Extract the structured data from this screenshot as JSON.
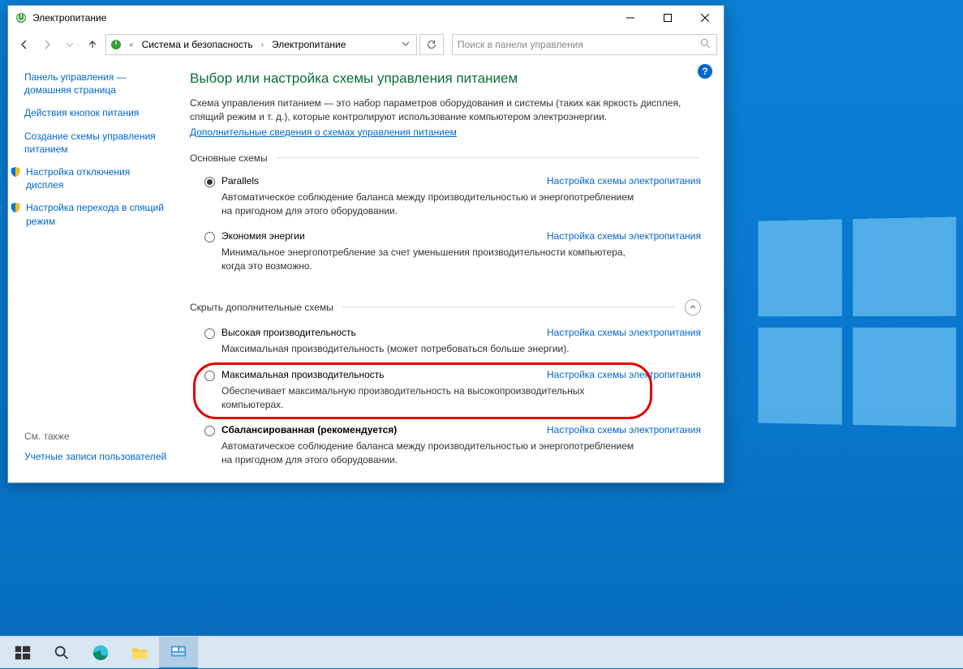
{
  "window": {
    "title": "Электропитание"
  },
  "breadcrumb": {
    "seg1": "Система и безопасность",
    "seg2": "Электропитание"
  },
  "search": {
    "placeholder": "Поиск в панели управления"
  },
  "sidebar": {
    "home": "Панель управления — домашняя страница",
    "item1": "Действия кнопок питания",
    "item2": "Создание схемы управления питанием",
    "item3": "Настройка отключения дисплея",
    "item4": "Настройка перехода в спящий режим",
    "see_also_label": "См. также",
    "see_also_item": "Учетные записи пользователей"
  },
  "content": {
    "heading": "Выбор или настройка схемы управления питанием",
    "desc": "Схема управления питанием — это набор параметров оборудования и системы (таких как яркость дисплея, спящий режим и т. д.), которые контролируют использование компьютером электроэнергии.",
    "desc_link": "Дополнительные сведения о схемах управления питанием",
    "section1_title": "Основные схемы",
    "section2_title": "Скрыть дополнительные схемы",
    "change_link": "Настройка схемы электропитания",
    "plans": [
      {
        "name": "Parallels",
        "desc": "Автоматическое соблюдение баланса между производительностью и энергопотреблением на пригодном для этого оборудовании.",
        "checked": true
      },
      {
        "name": "Экономия энергии",
        "desc": "Минимальное энергопотребление за счет уменьшения производительности компьютера, когда это возможно.",
        "checked": false
      },
      {
        "name": "Высокая производительность",
        "desc": "Максимальная производительность (может потребоваться больше энергии).",
        "checked": false
      },
      {
        "name": "Максимальная производительность",
        "desc": "Обеспечивает максимальную производительность на высокопроизводительных компьютерах.",
        "checked": false
      },
      {
        "name": "Сбалансированная (рекомендуется)",
        "desc": "Автоматическое соблюдение баланса между производительностью и энергопотреблением на пригодном для этого оборудовании.",
        "checked": false,
        "bold": true
      }
    ]
  }
}
